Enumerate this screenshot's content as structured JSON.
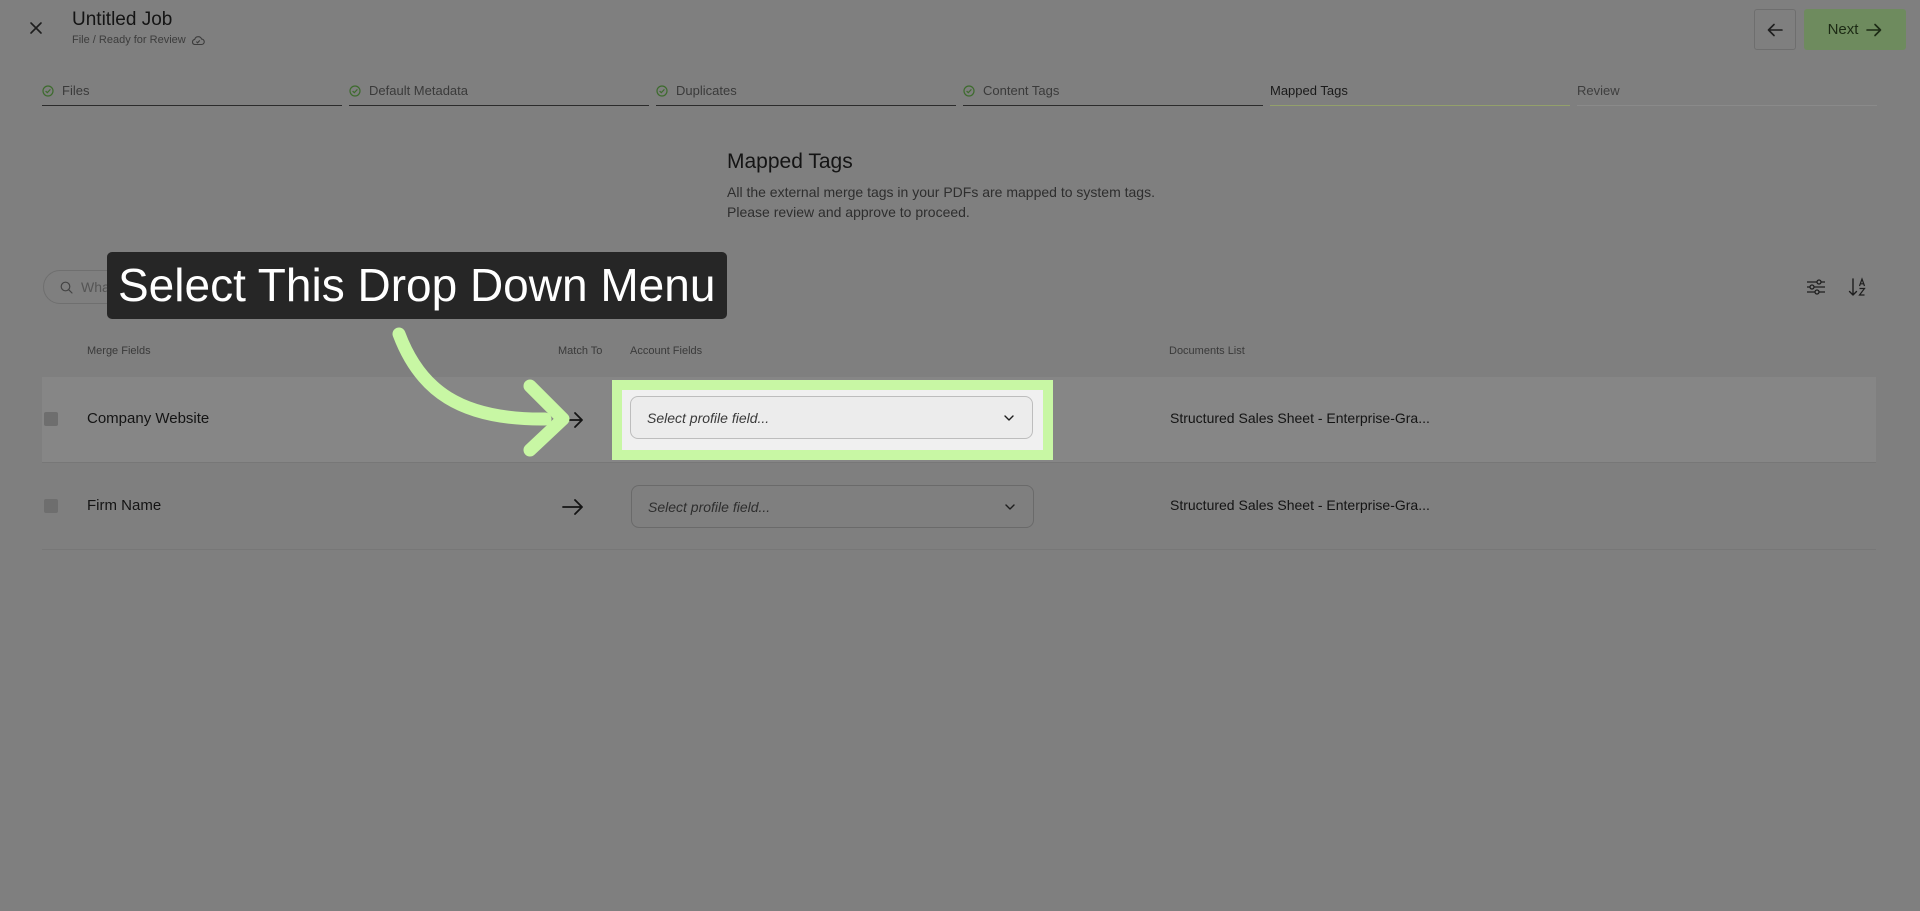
{
  "header": {
    "title": "Untitled Job",
    "subtitle": "File / Ready for Review",
    "next_label": "Next"
  },
  "steps": [
    {
      "label": "Files",
      "state": "done"
    },
    {
      "label": "Default Metadata",
      "state": "done"
    },
    {
      "label": "Duplicates",
      "state": "done"
    },
    {
      "label": "Content Tags",
      "state": "done"
    },
    {
      "label": "Mapped Tags",
      "state": "active"
    },
    {
      "label": "Review",
      "state": "pending"
    }
  ],
  "main": {
    "heading": "Mapped Tags",
    "description_line1": "All the external merge tags in your PDFs are mapped to system tags.",
    "description_line2": "Please review and approve to proceed."
  },
  "search": {
    "visible_text": "Wha"
  },
  "table": {
    "columns": {
      "merge_fields": "Merge Fields",
      "match_to": "Match To",
      "account_fields": "Account Fields",
      "documents_list": "Documents List"
    },
    "rows": [
      {
        "merge_field": "Company Website",
        "account_field_placeholder": "Select profile field...",
        "document": "Structured Sales Sheet - Enterprise-Gra..."
      },
      {
        "merge_field": "Firm Name",
        "account_field_placeholder": "Select profile field...",
        "document": "Structured Sales Sheet - Enterprise-Gra..."
      }
    ]
  },
  "callout": {
    "text": "Select This Drop Down Menu"
  },
  "colors": {
    "highlight": "#c8f7a4",
    "accent": "#6e8b5e",
    "overlay": "#7f7f7f"
  },
  "icons": [
    "close-icon",
    "cloud-icon",
    "arrow-left-icon",
    "arrow-right-icon",
    "check-circle-icon",
    "search-icon",
    "filter-sliders-icon",
    "sort-az-icon",
    "chevron-down-icon",
    "curved-arrow-icon"
  ]
}
